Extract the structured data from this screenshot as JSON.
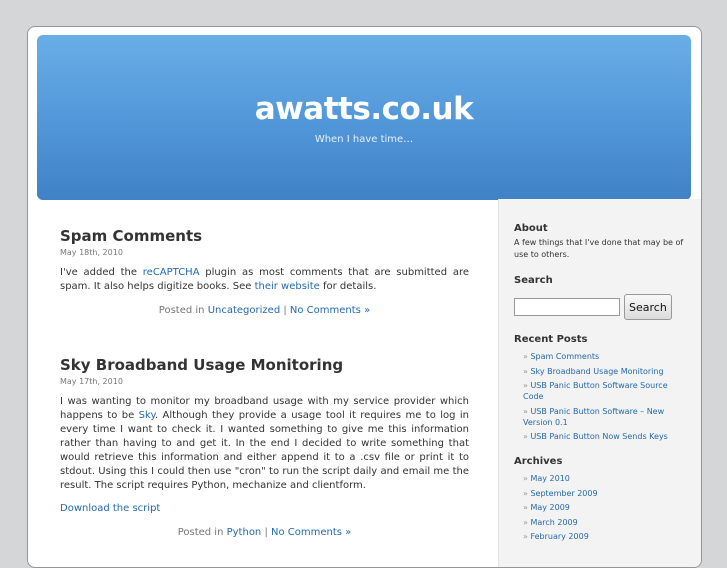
{
  "site": {
    "title": "awatts.co.uk",
    "tagline": "When I have time…"
  },
  "posts": [
    {
      "title": "Spam Comments",
      "date": "May 18th, 2010",
      "body": [
        {
          "t": "I've added the "
        },
        {
          "a": "reCAPTCHA"
        },
        {
          "t": " plugin as most comments that are submitted are spam.  It also helps digitize books.  See "
        },
        {
          "a": "their website"
        },
        {
          "t": " for details."
        }
      ],
      "posted_in": "Posted in ",
      "category": "Uncategorized",
      "separator": " | ",
      "comments": "No Comments »"
    },
    {
      "title": "Sky Broadband Usage Monitoring",
      "date": "May 17th, 2010",
      "body": [
        {
          "t": "I was wanting to monitor my broadband usage with my service provider which happens to be "
        },
        {
          "a": "Sky"
        },
        {
          "t": ".  Although they provide a usage tool it requires me to log in every time I want to check it.  I wanted something to give me this information rather than having to and get it.  In the end I decided to write something that would retrieve this information and either append it to a .csv file or print it to stdout.  Using this I could then use \"cron\" to run the script daily and email me the result.  The script requires Python, mechanize and clientform."
        }
      ],
      "download_link": "Download the script",
      "posted_in": "Posted in ",
      "category": "Python",
      "separator": " | ",
      "comments": "No Comments »"
    }
  ],
  "sidebar": {
    "about_heading": "About",
    "about_text": "A few things that I've done that may be of use to others.",
    "search_heading": "Search",
    "search_value": "",
    "search_button": "Search",
    "recent_heading": "Recent Posts",
    "recent": [
      "Spam Comments",
      "Sky Broadband Usage Monitoring",
      "USB Panic Button Software Source Code",
      "USB Panic Button Software – New Version 0.1",
      "USB Panic Button Now Sends Keys"
    ],
    "archives_heading": "Archives",
    "archives": [
      "May 2010",
      "September 2009",
      "May 2009",
      "March 2009",
      "February 2009"
    ],
    "bullet": "»"
  },
  "colors": {
    "link": "#2469ae",
    "header_top": "#69aee7",
    "header_bottom": "#3f82c6"
  }
}
